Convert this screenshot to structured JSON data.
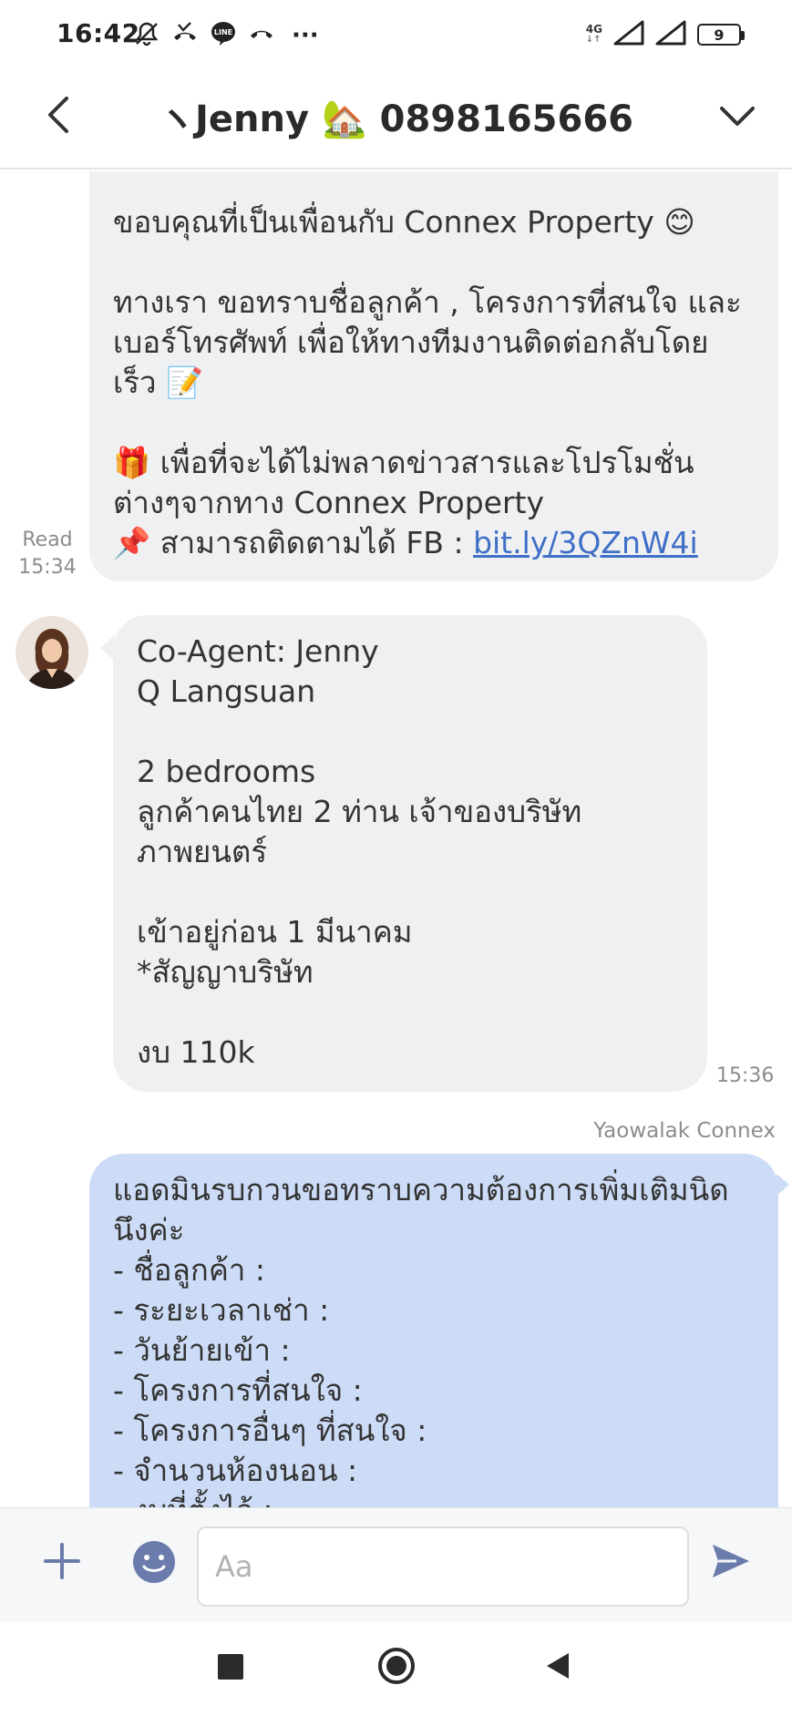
{
  "status_bar": {
    "time": "16:42",
    "more": "···",
    "network": "4G",
    "network_sub": "↓↑",
    "battery": "9"
  },
  "header": {
    "title": "ヽJenny 🏡 0898165666"
  },
  "messages": {
    "welcome": {
      "lines": [
        "ขอบคุณที่เป็นเพื่อนกับ Connex Property 😊",
        "",
        "ทางเรา ขอทราบชื่อลูกค้า , โครงการที่สนใจ และ",
        "เบอร์โทรศัพท์ เพื่อให้ทางทีมงานติดต่อกลับโดย",
        "เร็ว 📝",
        "",
        "🎁 เพื่อที่จะได้ไม่พลาดข่าวสารและโปรโมชั่น",
        "ต่างๆจากทาง Connex Property"
      ],
      "fb_prefix": "📌 สามารถติดตามได้ FB : ",
      "fb_link": "bit.ly/3QZnW4i",
      "read_label": "Read",
      "read_time": "15:34"
    },
    "incoming": {
      "lines": [
        "Co-Agent: Jenny",
        "Q Langsuan",
        "",
        "2 bedrooms",
        "ลูกค้าคนไทย 2 ท่าน เจ้าของบริษัท",
        "ภาพยนตร์",
        "",
        "เข้าอยู่ก่อน 1 มีนาคม",
        "*สัญญาบริษัท",
        "",
        "งบ 110k"
      ],
      "time": "15:36"
    },
    "outgoing": {
      "sender": "Yaowalak Connex",
      "lines": [
        "แอดมินรบกวนขอทราบความต้องการเพิ่มเติมนิด",
        "นึงค่ะ",
        "- ชื่อลูกค้า :",
        "- ระยะเวลาเช่า :",
        "- วันย้ายเข้า :",
        "- โครงการที่สนใจ :",
        "- โครงการอื่นๆ ที่สนใจ :",
        "- จำนวนห้องนอน :",
        "- งบที่ตั้งไว้ :"
      ]
    }
  },
  "input": {
    "placeholder": "Aa",
    "value": ""
  },
  "colors": {
    "incoming_bubble": "#eff0f2",
    "outgoing_bubble": "#cddcf6",
    "link": "#3f6fc6",
    "icon_accent": "#6b7bab"
  }
}
